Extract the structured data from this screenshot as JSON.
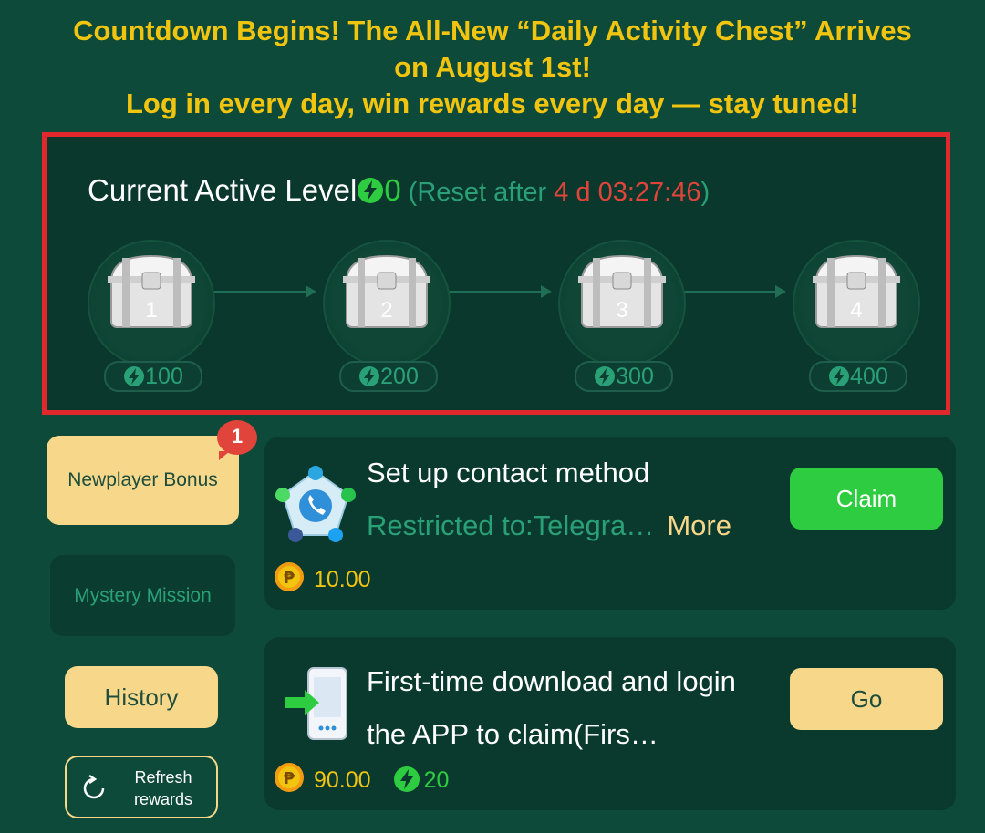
{
  "announcement": {
    "line1": "Countdown Begins! The All-New “Daily Activity Chest” Arrives",
    "line2": "on August 1st!",
    "line3": "Log in every day, win rewards every day — stay tuned!"
  },
  "level": {
    "title": "Current Active Level",
    "value": "0",
    "reset_prefix": "(Reset after ",
    "reset_time": "4 d 03:27:46",
    "reset_suffix": ")",
    "chests": [
      {
        "number": "1",
        "points": "100"
      },
      {
        "number": "2",
        "points": "200"
      },
      {
        "number": "3",
        "points": "300"
      },
      {
        "number": "4",
        "points": "400"
      }
    ]
  },
  "sidebar": {
    "newplayer_bonus": "Newplayer Bonus",
    "badge_count": "1",
    "mystery_mission": "Mystery Mission",
    "history": "History",
    "refresh_line1": "Refresh",
    "refresh_line2": "rewards"
  },
  "tasks": [
    {
      "title": "Set up contact method",
      "subtitle": "Restricted to:Telegra…",
      "more": "More",
      "reward": "10.00",
      "button": "Claim",
      "icon": "contact-methods-icon"
    },
    {
      "title": "First-time download and login the APP to claim(Firs…",
      "reward": "90.00",
      "activity": "20",
      "button": "Go",
      "icon": "download-app-icon"
    }
  ],
  "colors": {
    "background": "#0d4a3a",
    "accent_yellow": "#f1c40f",
    "highlight_border": "#e0282d",
    "claim_green": "#2ecc40",
    "button_cream": "#f7d88a"
  }
}
